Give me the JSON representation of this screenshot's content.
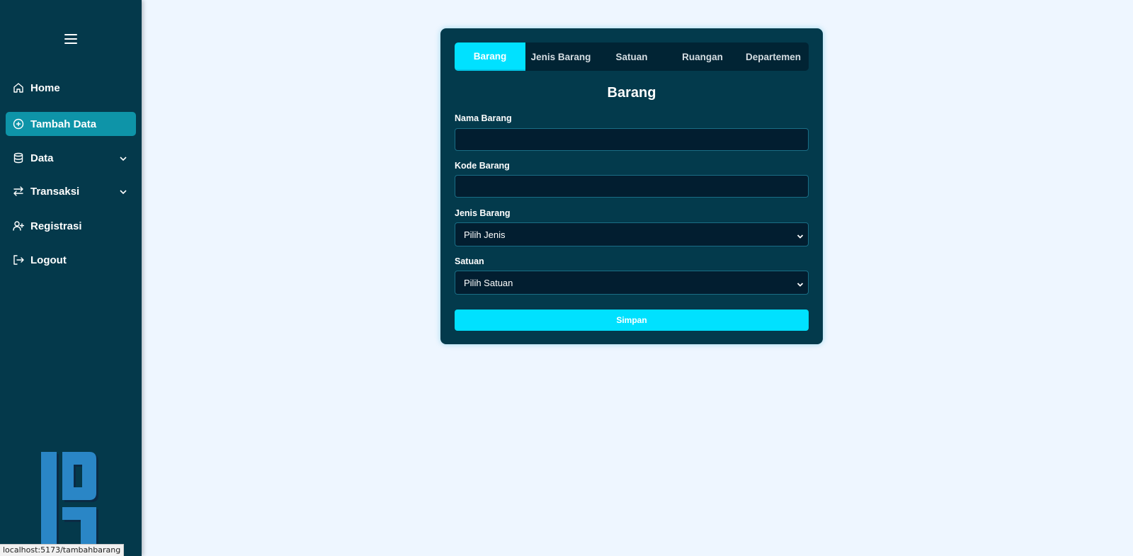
{
  "sidebar": {
    "menu_icon": "hamburger-icon",
    "items": [
      {
        "label": "Home",
        "icon": "home-icon"
      },
      {
        "label": "Tambah Data",
        "icon": "plus-circle-icon",
        "active": true
      },
      {
        "label": "Data",
        "icon": "database-icon",
        "has_submenu": true
      },
      {
        "label": "Transaksi",
        "icon": "transfer-arrows-icon",
        "has_submenu": true
      },
      {
        "label": "Registrasi",
        "icon": "user-plus-icon"
      },
      {
        "label": "Logout",
        "icon": "logout-icon"
      }
    ],
    "logo_icon": "app-logo"
  },
  "status_bar": {
    "url": "localhost:5173/tambahbarang"
  },
  "form_card": {
    "tabs": [
      {
        "label": "Barang",
        "active": true
      },
      {
        "label": "Jenis Barang"
      },
      {
        "label": "Satuan"
      },
      {
        "label": "Ruangan"
      },
      {
        "label": "Departemen"
      }
    ],
    "title": "Barang",
    "fields": {
      "nama_barang": {
        "label": "Nama Barang",
        "value": ""
      },
      "kode_barang": {
        "label": "Kode Barang",
        "value": ""
      },
      "jenis_barang": {
        "label": "Jenis Barang",
        "selected": "Pilih Jenis"
      },
      "satuan": {
        "label": "Satuan",
        "selected": "Pilih Satuan"
      }
    },
    "submit_label": "Simpan"
  },
  "colors": {
    "sidebar_bg": "#04394b",
    "page_bg": "#eef6ff",
    "card_bg": "#033a4c",
    "accent": "#00e1ff",
    "active_nav": "#0e94a8",
    "input_bg": "#021e30"
  }
}
